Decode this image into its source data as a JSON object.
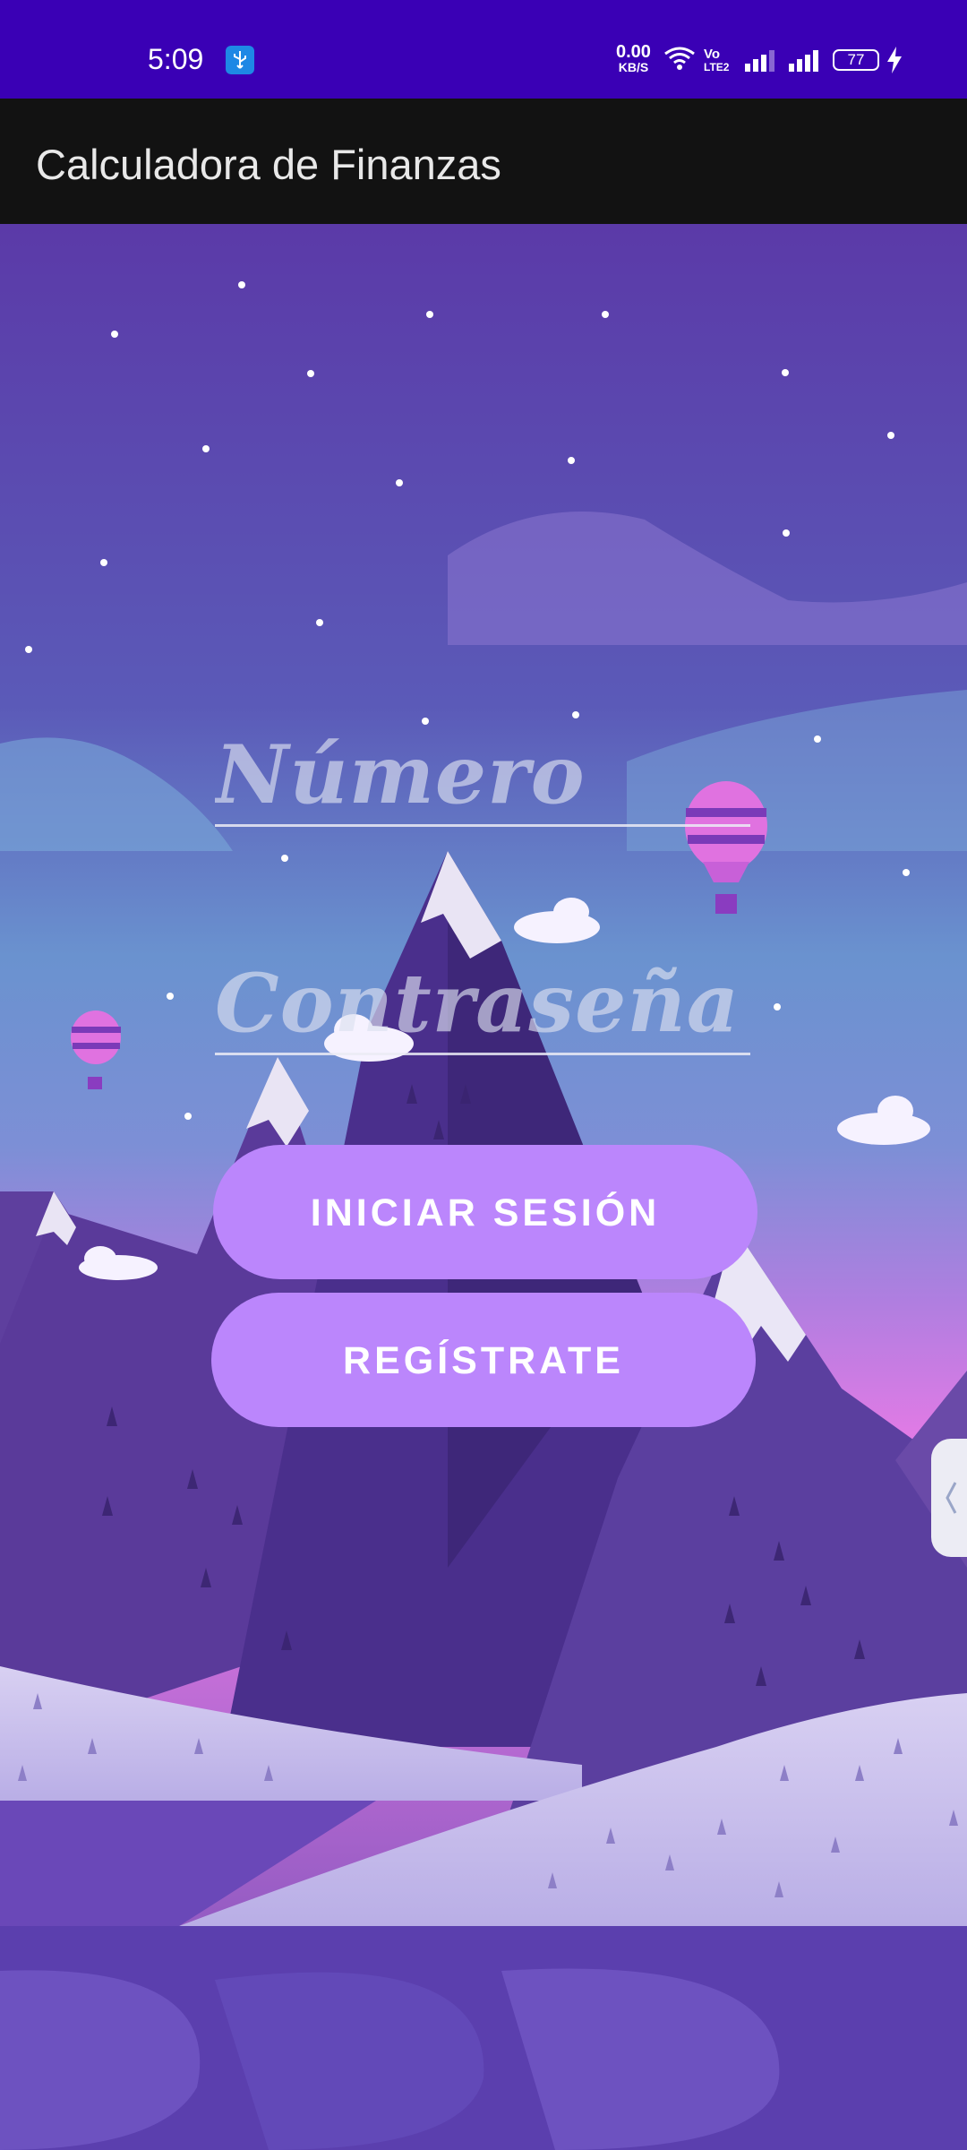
{
  "status_bar": {
    "time": "5:09",
    "net_speed_value": "0.00",
    "net_speed_unit": "KB/S",
    "volte_top": "Vo",
    "volte_bottom": "LTE2",
    "battery": "77"
  },
  "app_bar": {
    "title": "Calculadora de Finanzas"
  },
  "form": {
    "number_placeholder": "Número",
    "password_placeholder": "Contraseña",
    "login_label": "INICIAR SESIÓN",
    "register_label": "REGÍSTRATE"
  },
  "colors": {
    "status_bar": "#3a00b5",
    "app_bar": "#121212",
    "button": "#bb86fc",
    "sky_top": "#5b3aa8",
    "sky_mid": "#6d8fd0",
    "horizon": "#e879e8"
  },
  "icons": [
    "usb-icon",
    "wifi-icon",
    "signal-icon",
    "battery-icon",
    "charging-icon",
    "chevron-left-icon"
  ]
}
